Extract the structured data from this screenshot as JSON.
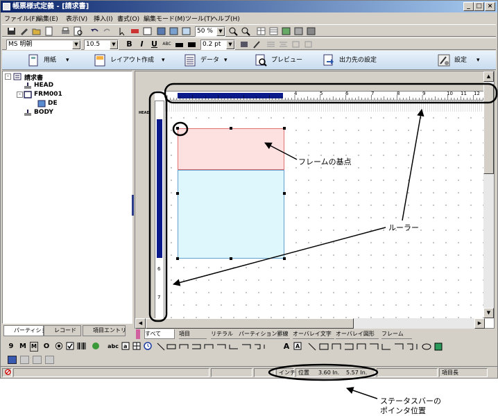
{
  "window": {
    "title": "帳票様式定義 - [請求書]",
    "buttons": [
      "_",
      "□",
      "×"
    ]
  },
  "menu": [
    "ファイル(F)",
    "編集(E)",
    "表示(V)",
    "挿入(I)",
    "書式(O)",
    "編集モード(M)",
    "ツール(T)",
    "ヘルプ(H)"
  ],
  "toolbar1": {
    "zoom": "50 %"
  },
  "toolbar2": {
    "font_name": "MS 明朝",
    "font_size": "10.5",
    "bold": "B",
    "italic": "I",
    "underline": "U",
    "strike": "ABC",
    "line_width": "0.2 pt"
  },
  "ribbon": [
    {
      "label": "用紙",
      "icon": "paper-icon"
    },
    {
      "label": "レイアウト作成",
      "icon": "layout-icon"
    },
    {
      "label": "データ",
      "icon": "data-icon"
    },
    {
      "label": "プレビュー",
      "icon": "preview-icon"
    },
    {
      "label": "出力先の設定",
      "icon": "output-icon"
    },
    {
      "label": "設定",
      "icon": "settings-icon"
    }
  ],
  "tree": {
    "root": "請求書",
    "items": [
      "HEAD",
      "FRM001",
      "DE",
      "BODY"
    ]
  },
  "left_tabs": [
    "パーティション",
    "レコード",
    "項目エントリ"
  ],
  "ruler": {
    "h_numbers": [
      "4",
      "5",
      "6",
      "7",
      "8",
      "9",
      "10",
      "11",
      "12"
    ],
    "v_numbers": [
      "6",
      "7"
    ],
    "head_label": "HEAD"
  },
  "bottom_tabs": [
    "すべて",
    "項目",
    "リテラル",
    "パーティション罫線",
    "オーバレイ文字",
    "オーバレイ図形",
    "フレーム"
  ],
  "draw_tools": [
    "9",
    "M",
    "M",
    "O",
    "abc",
    "A"
  ],
  "status": {
    "unit": "インチ",
    "position_label": "位置",
    "x": "3.60 In.",
    "y": "5.57 In.",
    "item_length": "項目長"
  },
  "callouts": {
    "frame_origin": "フレームの基点",
    "ruler": "ルーラー",
    "status_line1": "ステータスバーの",
    "status_line2": "ポインタ位置"
  },
  "colors": {
    "title_start": "#0a246a",
    "title_end": "#a6caf0",
    "frame_pink": "#fde0e0",
    "frame_cyan": "#def7fc",
    "ruler_bar": "#0a1a8a"
  }
}
